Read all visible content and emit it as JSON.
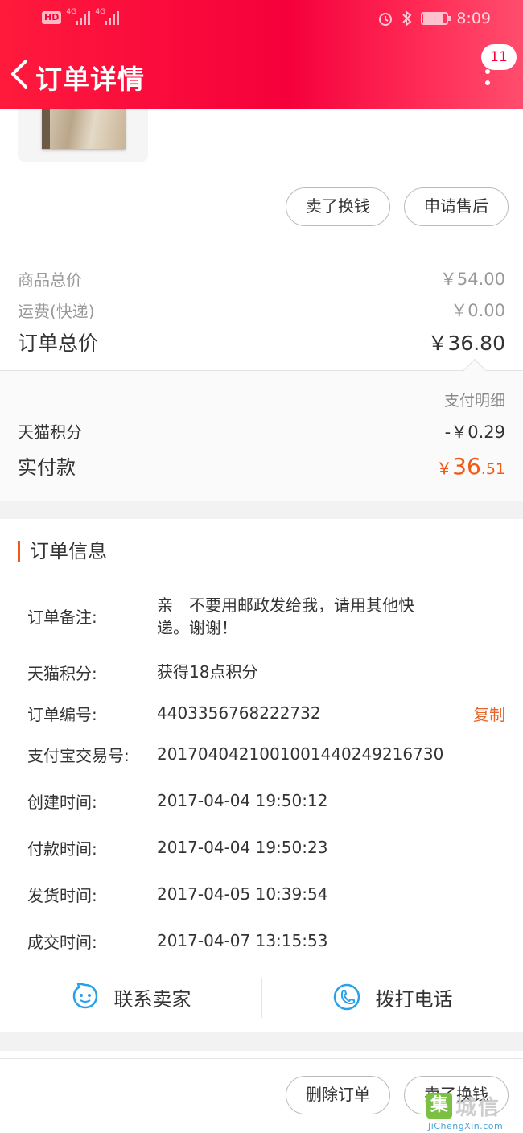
{
  "status_bar": {
    "hd_label": "HD",
    "network_1": "4G",
    "network_2": "4G",
    "time": "8:09"
  },
  "header": {
    "title": "订单详情",
    "message_count": "11"
  },
  "order_actions": {
    "sell_label": "卖了换钱",
    "after_sale_label": "申请售后"
  },
  "price_summary": {
    "goods_total_label": "商品总价",
    "goods_total_value": "￥54.00",
    "shipping_label": "运费(快递)",
    "shipping_value": "￥0.00",
    "order_total_label": "订单总价",
    "order_total_value": "￥36.80"
  },
  "payment": {
    "detail_link": "支付明细",
    "points_label": "天猫积分",
    "points_value": "-￥0.29",
    "paid_label": "实付款",
    "paid_currency": "￥",
    "paid_integer": "36",
    "paid_decimal": ".51"
  },
  "order_info": {
    "section_title": "订单信息",
    "rows": [
      {
        "key": "订单备注:",
        "value": "亲　不要用邮政发给我，请用其他快递。谢谢！"
      },
      {
        "key": "天猫积分:",
        "value": "获得18点积分"
      },
      {
        "key": "订单编号:",
        "value": "4403356768222732"
      },
      {
        "key": "支付宝交易号:",
        "value": "2017040421001001440249216730"
      },
      {
        "key": "创建时间:",
        "value": "2017-04-04 19:50:12"
      },
      {
        "key": "付款时间:",
        "value": "2017-04-04 19:50:23"
      },
      {
        "key": "发货时间:",
        "value": "2017-04-05 10:39:54"
      },
      {
        "key": "成交时间:",
        "value": "2017-04-07 13:15:53"
      }
    ],
    "copy_label": "复制"
  },
  "contact": {
    "seller_label": "联系卖家",
    "call_label": "拨打电话"
  },
  "bottom_actions": {
    "delete_label": "删除订单",
    "sell_label": "卖了换钱"
  },
  "watermark": {
    "logo_char": "集",
    "name": "城信",
    "url": "JiChengXin.com"
  },
  "colors": {
    "header_red": "#f5003b",
    "accent_orange": "#f05a16",
    "icon_blue": "#2aa0e8"
  }
}
